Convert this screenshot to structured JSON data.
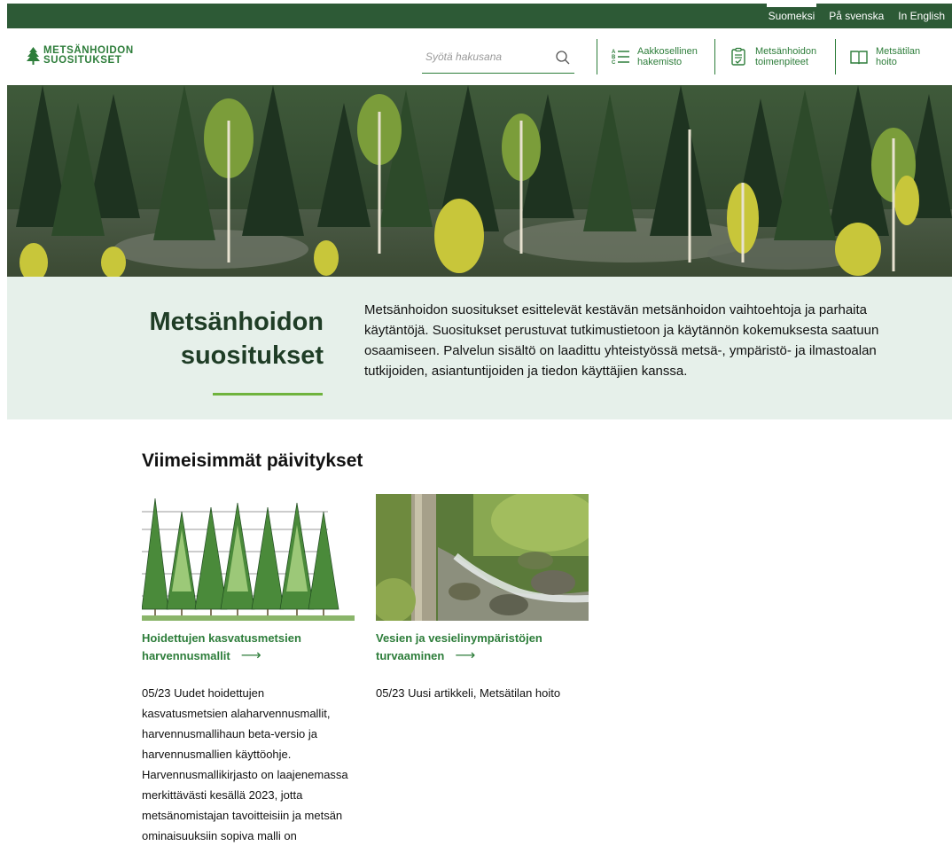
{
  "languages": [
    {
      "label": "Suomeksi",
      "active": true
    },
    {
      "label": "På svenska",
      "active": false
    },
    {
      "label": "In English",
      "active": false
    }
  ],
  "logo": {
    "line1": "METSÄNHOIDON",
    "line2": "SUOSITUKSET",
    "icon": "tree-icon"
  },
  "search": {
    "placeholder": "Syötä hakusana",
    "value": "",
    "icon": "search-icon"
  },
  "nav": [
    {
      "line1": "Aakkosellinen",
      "line2": "hakemisto",
      "icon": "abc-list-icon"
    },
    {
      "line1": "Metsänhoidon",
      "line2": "toimenpiteet",
      "icon": "clipboard-check-icon"
    },
    {
      "line1": "Metsätilan",
      "line2": "hoito",
      "icon": "open-book-icon"
    }
  ],
  "intro": {
    "title_line1": "Metsänhoidon",
    "title_line2": "suositukset",
    "text": "Metsänhoidon suositukset esittelevät kestävän metsänhoidon vaihtoehtoja ja parhaita käytäntöjä. Suositukset perustuvat tutkimustietoon ja käytännön kokemuksesta saatuun osaamiseen. Palvelun sisältö on laadittu yhteistyössä metsä-, ympäristö- ja ilmastoalan tutkijoiden, asiantuntijoiden ja tiedon käyttäjien kanssa."
  },
  "updates": {
    "title": "Viimeisimmät päivitykset",
    "cards": [
      {
        "link_line1": "Hoidettujen kasvatusmetsien",
        "link_line2": "harvennusmallit",
        "arrow": "⟶",
        "text": "05/23 Uudet hoidettujen kasvatusmetsien alaharvennusmallit, harvennusmallihaun beta-versio ja harvennusmallien käyttöohje. Harvennusmallikirjasto on laajenemassa merkittävästi kesällä 2023, jotta metsänomistajan tavoitteisiin ja metsän ominaisuuksiin sopiva malli on"
      },
      {
        "link_line1": "Vesien ja vesielinympäristöjen",
        "link_line2": "turvaaminen",
        "arrow": "⟶",
        "text": "05/23 Uusi artikkeli, Metsätilan hoito"
      }
    ]
  },
  "colors": {
    "brand_dark": "#2d5a36",
    "brand": "#2d7d3a",
    "accent": "#6fb33d",
    "intro_bg": "#e6f0ea"
  }
}
